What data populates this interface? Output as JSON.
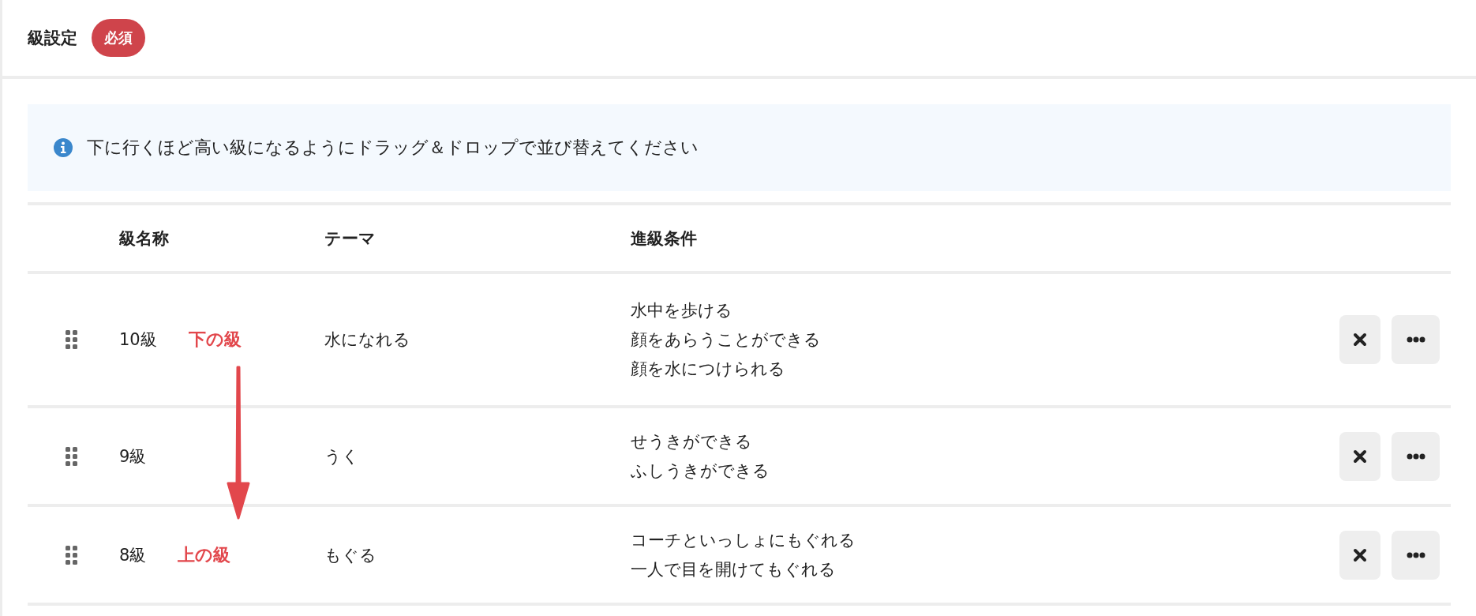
{
  "section": {
    "title": "級設定",
    "badge": "必須"
  },
  "info": {
    "text": "下に行くほど高い級になるようにドラッグ＆ドロップで並び替えてください"
  },
  "table": {
    "columns": [
      "級名称",
      "テーマ",
      "進級条件"
    ],
    "rows": [
      {
        "name": "10級",
        "annotation": "下の級",
        "theme": "水になれる",
        "conditions": [
          "水中を歩ける",
          "顔をあらうことができる",
          "顔を水につけられる"
        ]
      },
      {
        "name": "9級",
        "theme": "うく",
        "conditions": [
          "せうきができる",
          "ふしうきができる"
        ]
      },
      {
        "name": "8級",
        "annotation": "上の級",
        "theme": "もぐる",
        "conditions": [
          "コーチといっしょにもぐれる",
          "一人で目を開けてもぐれる"
        ]
      }
    ]
  }
}
